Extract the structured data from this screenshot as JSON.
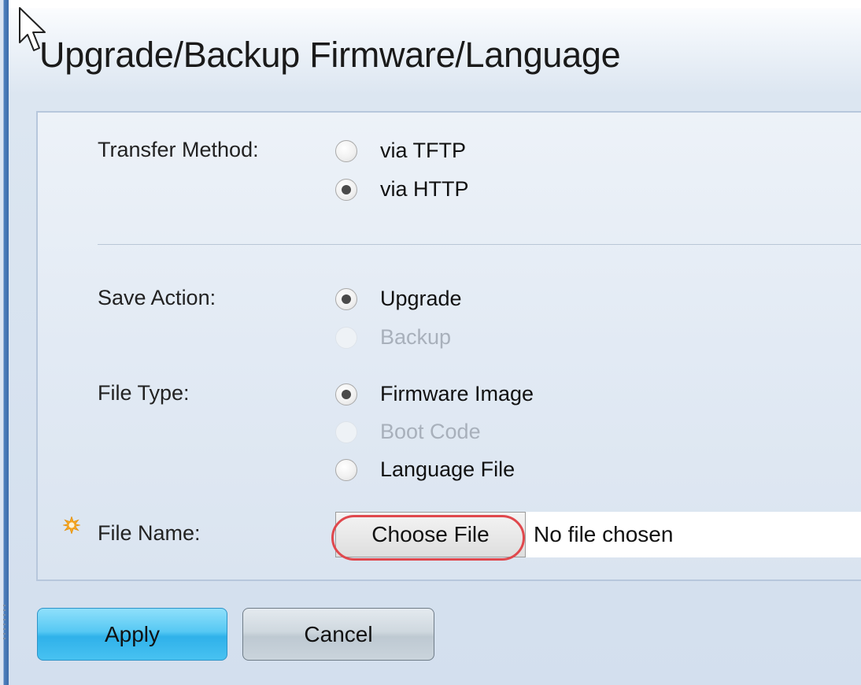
{
  "page": {
    "title": "Upgrade/Backup Firmware/Language"
  },
  "transfer_method": {
    "label": "Transfer Method:",
    "options": [
      {
        "label": "via TFTP",
        "checked": false,
        "disabled": false
      },
      {
        "label": "via HTTP",
        "checked": true,
        "disabled": false
      }
    ]
  },
  "save_action": {
    "label": "Save Action:",
    "options": [
      {
        "label": "Upgrade",
        "checked": true,
        "disabled": false
      },
      {
        "label": "Backup",
        "checked": false,
        "disabled": true
      }
    ]
  },
  "file_type": {
    "label": "File Type:",
    "options": [
      {
        "label": "Firmware Image",
        "checked": true,
        "disabled": false
      },
      {
        "label": "Boot Code",
        "checked": false,
        "disabled": true
      },
      {
        "label": "Language File",
        "checked": false,
        "disabled": false
      }
    ]
  },
  "file_name": {
    "label": "File Name:",
    "choose_button": "Choose File",
    "status": "No file chosen",
    "required_icon": "required-star-icon",
    "required_color": "#f5a623"
  },
  "actions": {
    "apply": "Apply",
    "cancel": "Cancel"
  },
  "colors": {
    "apply_button": "#48c2f1",
    "highlight": "#e0484d"
  }
}
